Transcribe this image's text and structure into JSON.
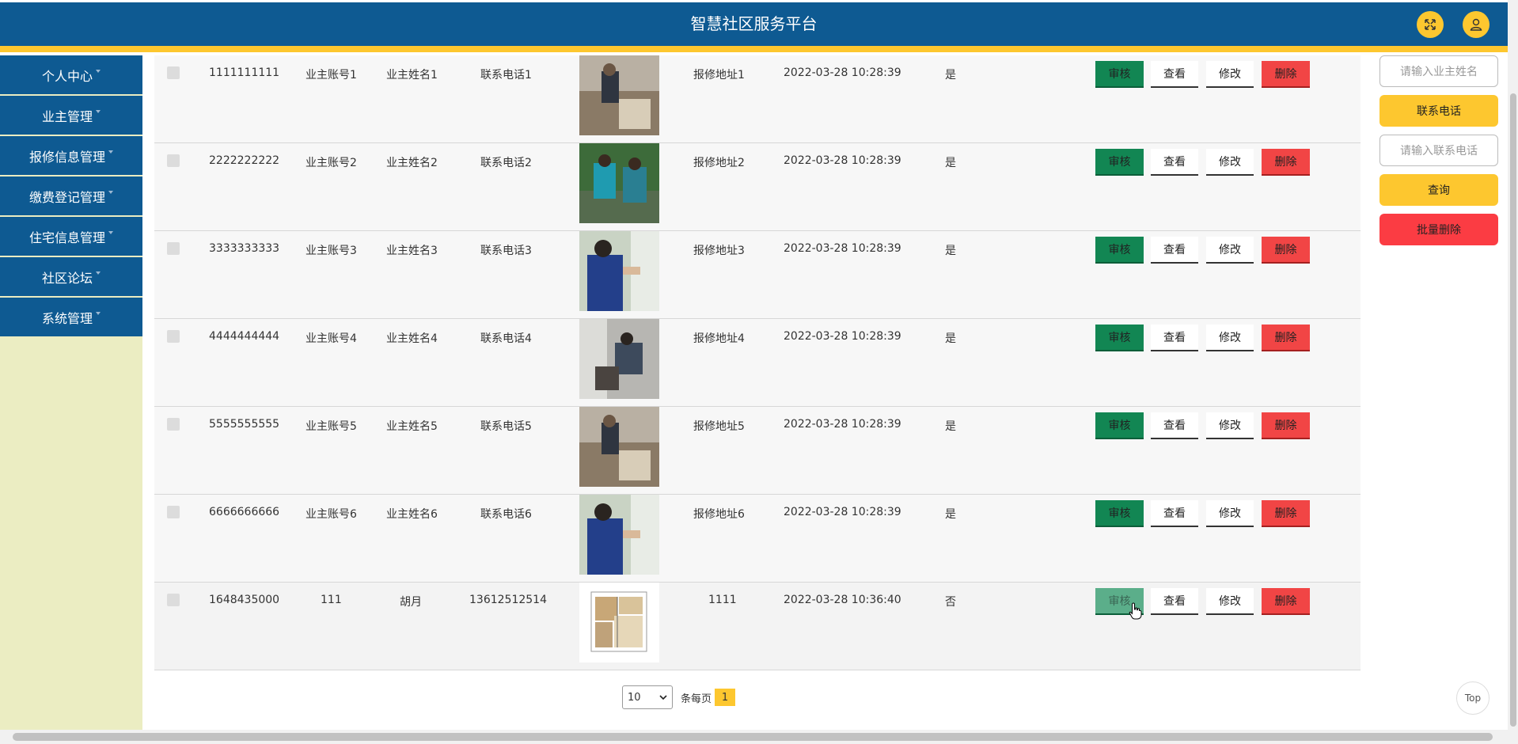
{
  "header": {
    "title": "智慧社区服务平台",
    "fullscreen_icon": "expand-icon",
    "user_icon": "user-icon"
  },
  "sidebar": {
    "items": [
      {
        "label": "个人中心"
      },
      {
        "label": "业主管理"
      },
      {
        "label": "报修信息管理"
      },
      {
        "label": "缴费登记管理"
      },
      {
        "label": "住宅信息管理"
      },
      {
        "label": "社区论坛"
      },
      {
        "label": "系统管理"
      }
    ]
  },
  "table": {
    "rows": [
      {
        "id": "1111111111",
        "account": "业主账号1",
        "name": "业主姓名1",
        "phone": "联系电话1",
        "address": "报修地址1",
        "time": "2022-03-28 10:28:39",
        "status": "是"
      },
      {
        "id": "2222222222",
        "account": "业主账号2",
        "name": "业主姓名2",
        "phone": "联系电话2",
        "address": "报修地址2",
        "time": "2022-03-28 10:28:39",
        "status": "是"
      },
      {
        "id": "3333333333",
        "account": "业主账号3",
        "name": "业主姓名3",
        "phone": "联系电话3",
        "address": "报修地址3",
        "time": "2022-03-28 10:28:39",
        "status": "是"
      },
      {
        "id": "4444444444",
        "account": "业主账号4",
        "name": "业主姓名4",
        "phone": "联系电话4",
        "address": "报修地址4",
        "time": "2022-03-28 10:28:39",
        "status": "是"
      },
      {
        "id": "5555555555",
        "account": "业主账号5",
        "name": "业主姓名5",
        "phone": "联系电话5",
        "address": "报修地址5",
        "time": "2022-03-28 10:28:39",
        "status": "是"
      },
      {
        "id": "6666666666",
        "account": "业主账号6",
        "name": "业主姓名6",
        "phone": "联系电话6",
        "address": "报修地址6",
        "time": "2022-03-28 10:28:39",
        "status": "是"
      },
      {
        "id": "1648435000",
        "account": "111",
        "name": "胡月",
        "phone": "13612512514",
        "address": "1111",
        "time": "2022-03-28 10:36:40",
        "status": "否"
      }
    ],
    "actions": {
      "audit": "审核",
      "view": "查看",
      "edit": "修改",
      "delete": "删除"
    }
  },
  "search_panel": {
    "owner_name_placeholder": "请输入业主姓名",
    "phone_label": "联系电话",
    "phone_placeholder": "请输入联系电话",
    "search_button": "查询",
    "batch_delete_button": "批量删除"
  },
  "pagination": {
    "page_size": "10",
    "per_page_label": "条每页",
    "current_page": "1"
  },
  "back_to_top": "Top",
  "colors": {
    "primary": "#0e5a92",
    "accent": "#fdc72f",
    "audit": "#128653",
    "danger": "#f14545"
  }
}
